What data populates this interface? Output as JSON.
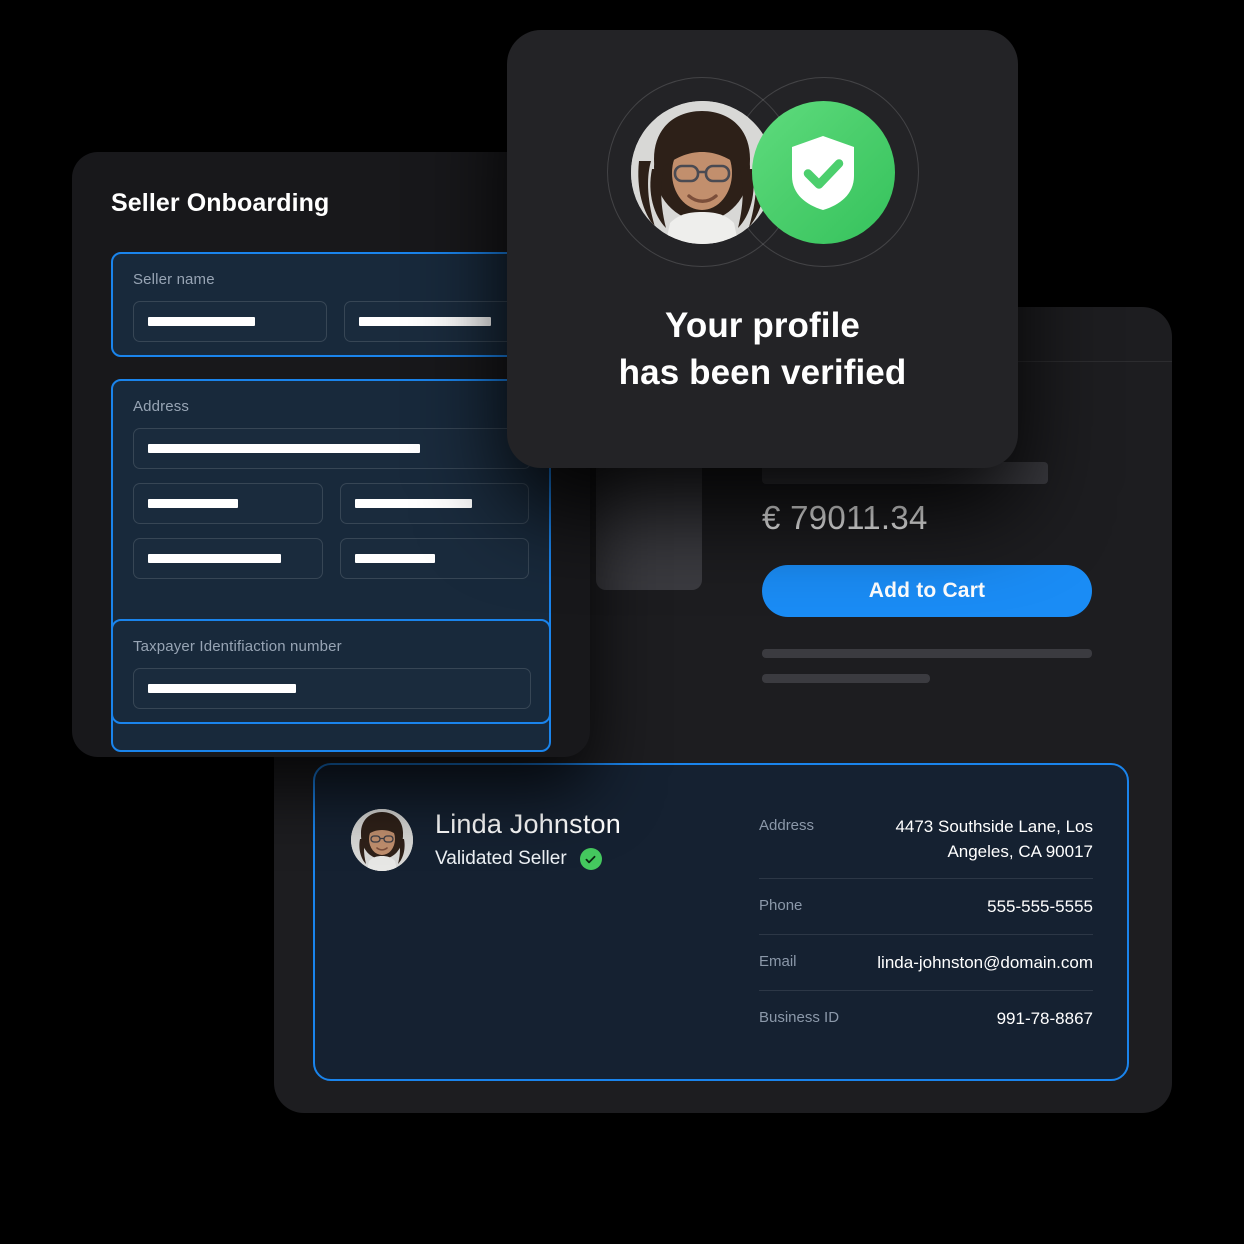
{
  "onboarding": {
    "title": "Seller Onboarding",
    "fields": [
      {
        "label": "Seller name"
      },
      {
        "label": "Address"
      },
      {
        "label": "Taxpayer Identifiaction number"
      }
    ]
  },
  "product": {
    "price": "€ 79011.34",
    "add_to_cart_label": "Add to Cart"
  },
  "verified_modal": {
    "headline_line1": "Your profile",
    "headline_line2": "has been verified",
    "shield_icon": "shield-check-icon",
    "accent_green": "#4ccf6d"
  },
  "seller": {
    "name": "Linda Johnston",
    "status": "Validated Seller",
    "status_icon": "check-circle-icon",
    "avatar_icon": "user-avatar",
    "details": [
      {
        "label": "Address",
        "value": "4473 Southside Lane, Los Angeles, CA 90017"
      },
      {
        "label": "Phone",
        "value": "555-555-5555"
      },
      {
        "label": "Email",
        "value": "linda-johnston@domain.com"
      },
      {
        "label": "Business ID",
        "value": "991-78-8867"
      }
    ]
  },
  "colors": {
    "accent_blue": "#1a8cf5",
    "border_blue": "#1a84ec",
    "success_green": "#45c95f",
    "card_dark": "#1d1d20",
    "card_navy": "#152131"
  }
}
